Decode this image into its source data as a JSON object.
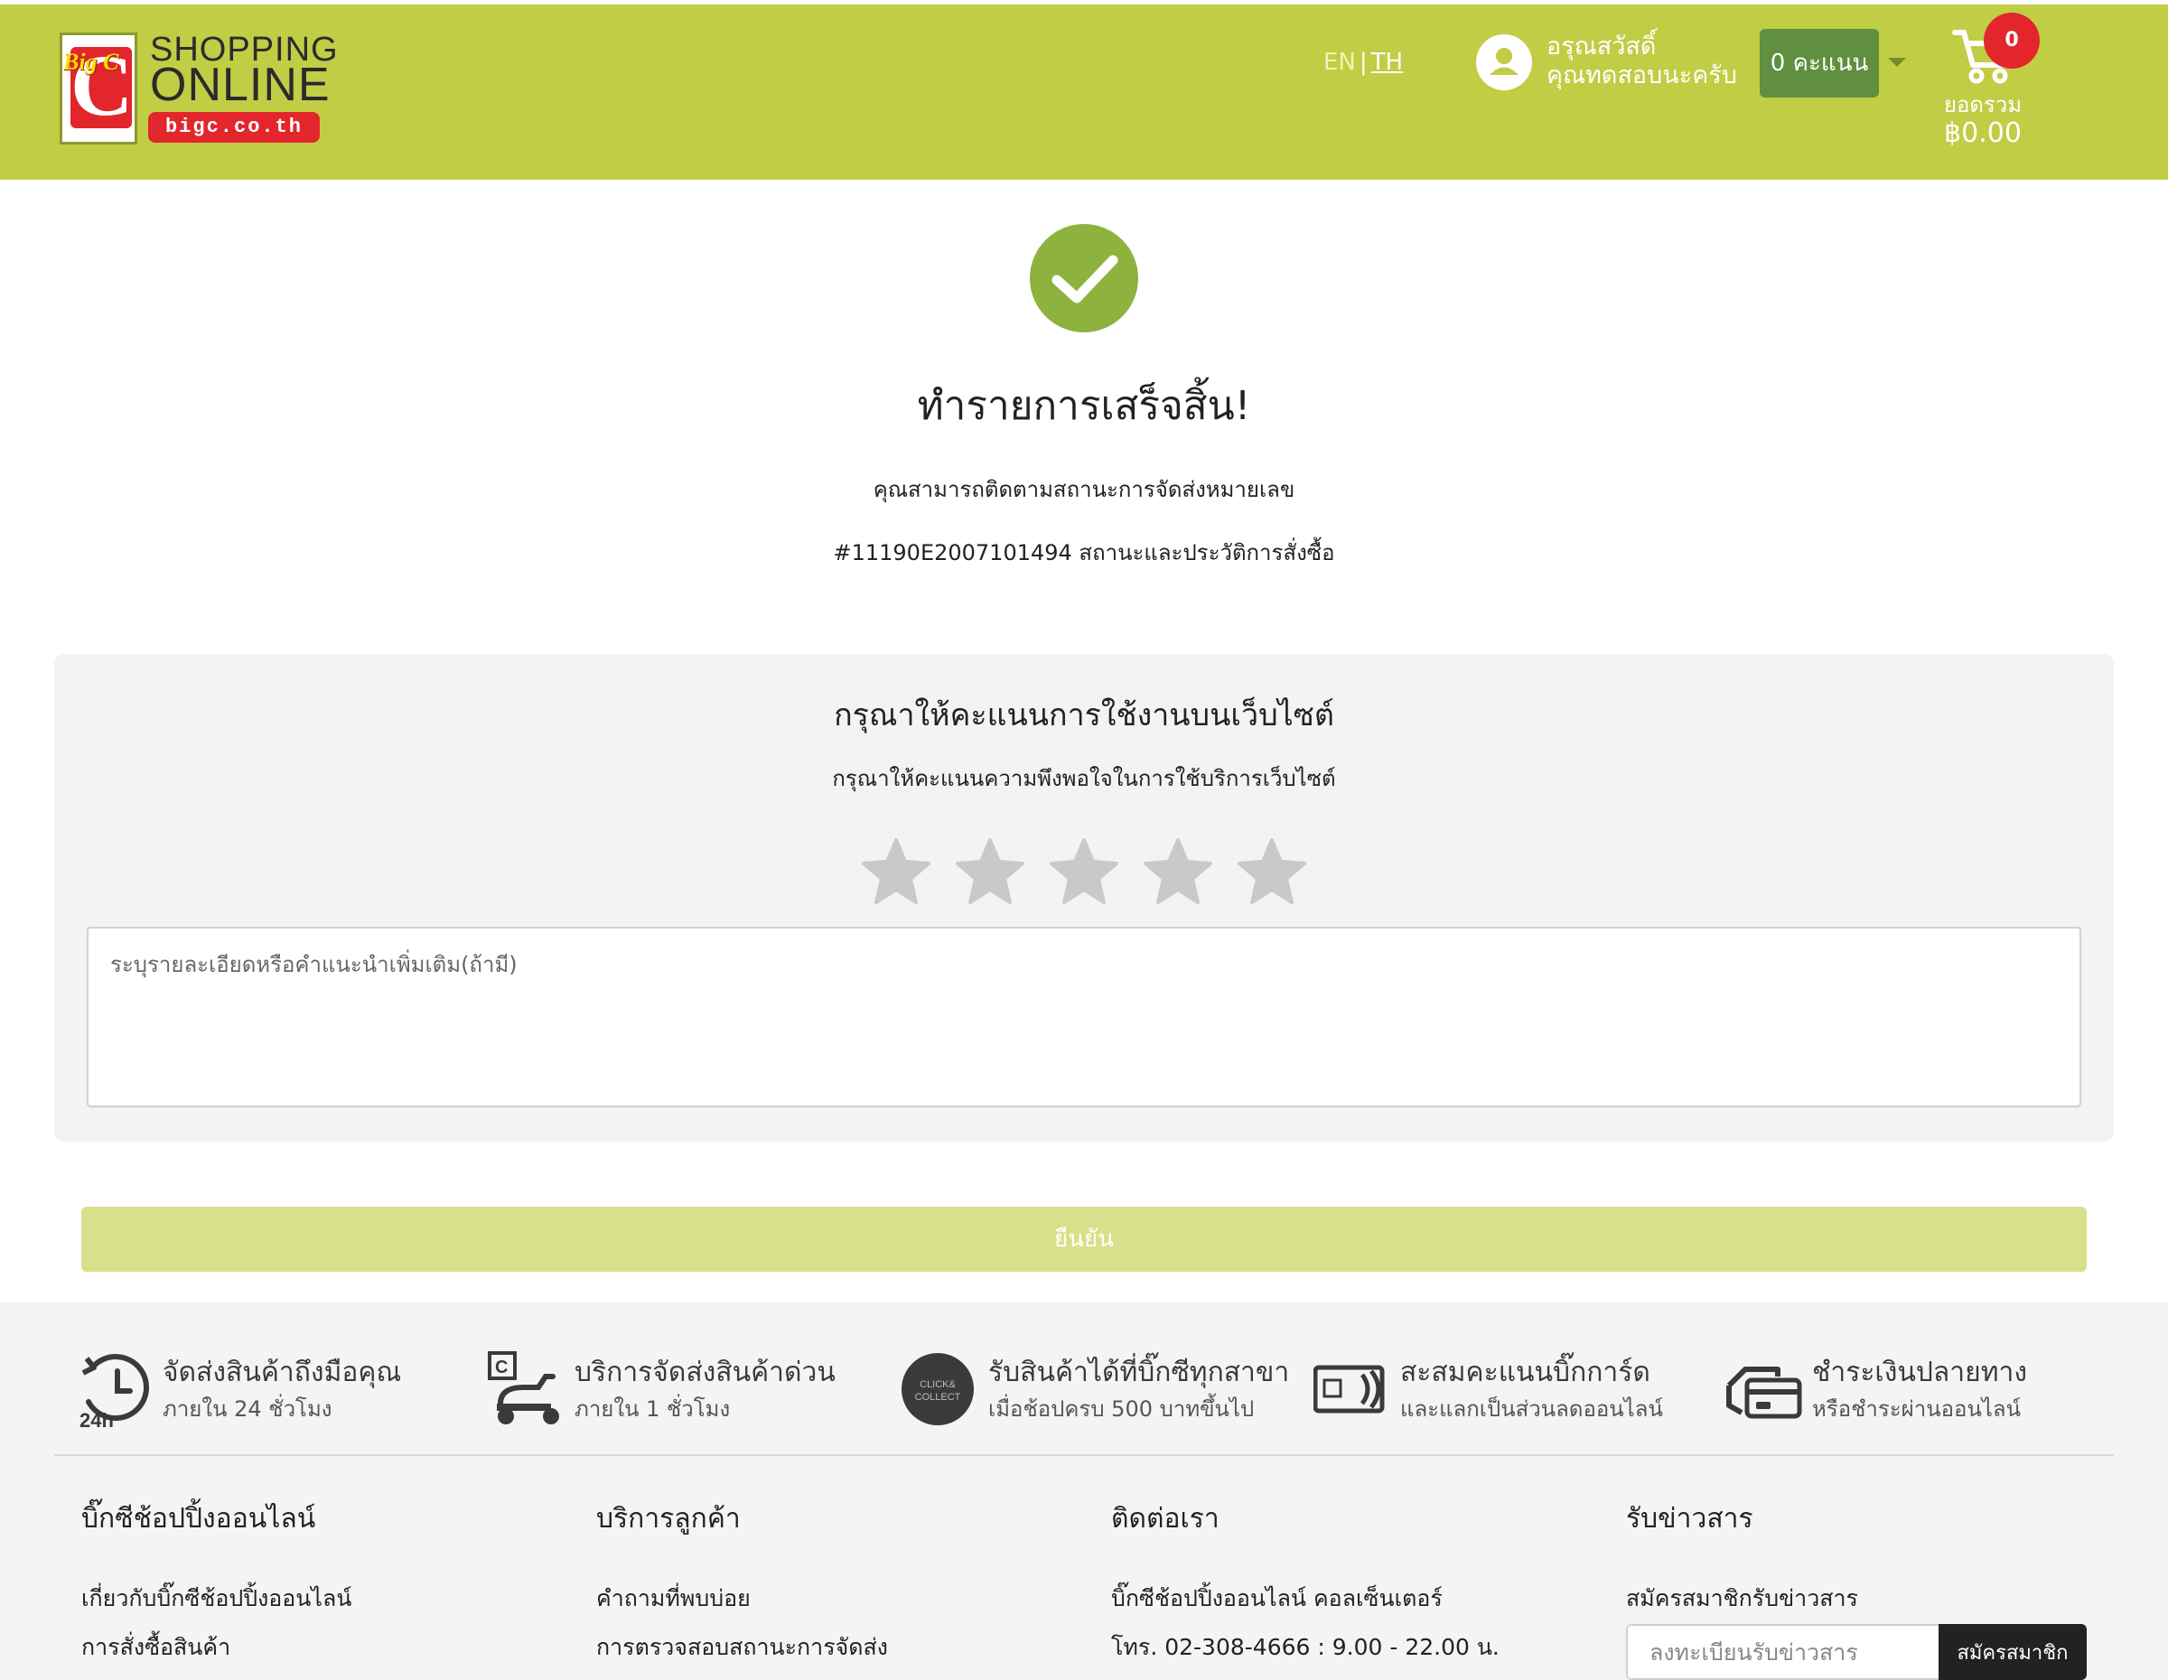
{
  "header": {
    "logo": {
      "brand": "Big C",
      "line1": "SHOPPING",
      "line2": "ONLINE",
      "url": "bigc.co.th"
    },
    "lang": {
      "en": "EN",
      "separator": "|",
      "th": "TH"
    },
    "user": {
      "greeting": "อรุณสวัสดิ์",
      "name": "คุณทดสอบนะครับ",
      "icon": "user-icon"
    },
    "points_label": "0 คะแนน",
    "cart": {
      "count": "0",
      "label": "ยอดรวม",
      "total": "฿0.00",
      "icon": "cart-icon"
    },
    "colors": {
      "header_bg": "#c1cd44",
      "points_bg": "#5f8f3f",
      "badge": "#e2262c"
    }
  },
  "success": {
    "icon": "check-circle-icon",
    "title": "ทำรายการเสร็จสิ้น!",
    "line1": "คุณสามารถติดตามสถานะการจัดส่งหมายเลข",
    "line2": "#11190E2007101494 สถานะและประวัติการสั่งซื้อ",
    "color": "#8db33e"
  },
  "rating": {
    "title": "กรุณาให้คะแนนการใช้งานบนเว็บไซต์",
    "subtitle": "กรุณาให้คะแนนความพึงพอใจในการใช้บริการเว็บไซต์",
    "stars": 5,
    "selected": 0,
    "comment_placeholder": "ระบุรายละเอียดหรือคำแนะนำเพิ่มเติม(ถ้ามี)",
    "confirm_label": "ยืนยัน"
  },
  "features": [
    {
      "icon": "clock-24h-icon",
      "title": "จัดส่งสินค้าถึงมือคุณ",
      "sub": "ภายใน 24 ชั่วโมง",
      "badge": "24h"
    },
    {
      "icon": "scooter-icon",
      "title": "บริการจัดส่งสินค้าด่วน",
      "sub": "ภายใน 1 ชั่วโมง"
    },
    {
      "icon": "click-collect-icon",
      "title": "รับสินค้าได้ที่บิ๊กซีทุกสาขา",
      "sub": "เมื่อช้อปครบ 500 บาทขึ้นไป",
      "badge": "CLICK& COLLECT"
    },
    {
      "icon": "bigcard-icon",
      "title": "สะสมคะแนนบิ๊กการ์ด",
      "sub": "และแลกเป็นส่วนลดออนไลน์"
    },
    {
      "icon": "card-payment-icon",
      "title": "ชำระเงินปลายทาง",
      "sub": "หรือชำระผ่านออนไลน์"
    }
  ],
  "footer": {
    "col1": {
      "title": "บิ๊กซีช้อปปิ้งออนไลน์",
      "links": [
        "เกี่ยวกับบิ๊กซีช้อปปิ้งออนไลน์",
        "การสั่งซื้อสินค้า"
      ]
    },
    "col2": {
      "title": "บริการลูกค้า",
      "links": [
        "คำถามที่พบบ่อย",
        "การตรวจสอบสถานะการจัดส่ง"
      ]
    },
    "col3": {
      "title": "ติดต่อเรา",
      "links": [
        "บิ๊กซีช้อปปิ้งออนไลน์ คอลเซ็นเตอร์",
        "โทร. 02-308-4666 : 9.00 - 22.00 น."
      ]
    },
    "col4": {
      "title": "รับข่าวสาร",
      "text": "สมัครสมาชิกรับข่าวสาร",
      "input_placeholder": "ลงทะเบียนรับข่าวสาร",
      "button": "สมัครสมาชิก"
    }
  }
}
